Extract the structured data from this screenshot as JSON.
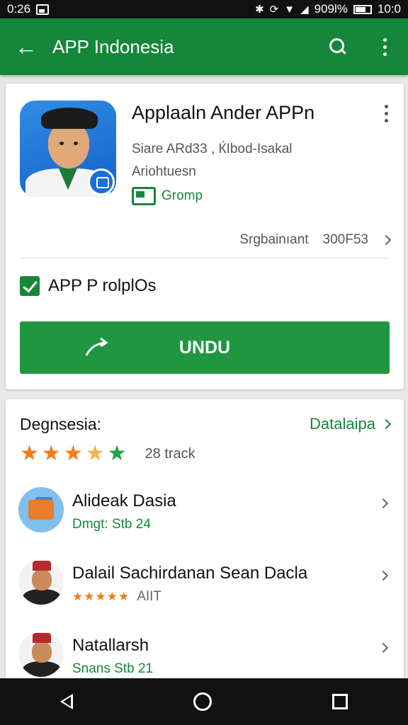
{
  "status_bar": {
    "time": "0:26",
    "battery": "909l%",
    "clock": "10:0"
  },
  "app_bar": {
    "title": "APP Indonesia"
  },
  "app": {
    "title": "Applaaln Ander APPn",
    "developer": "Siare ARd33 , ЌІbod-Isakal",
    "category": "Ariohtuesn",
    "group": "Gromp",
    "meta_label": "Srgbainıant",
    "meta_value": "300F53"
  },
  "checkbox_label": "APP P rolplOs",
  "install_label": "UNDU",
  "reviews": {
    "heading": "Degnsesia:",
    "link": "Datalaipa",
    "rating": 3.5,
    "count": "28 track"
  },
  "list": [
    {
      "name": "Alideak Dasia",
      "sub": "Dmgt: Stb 24"
    },
    {
      "name": "Dalail Sachirdanan Sean Dacla",
      "stars": "★★★★★",
      "sub": "AIIT"
    },
    {
      "name": "Natallarsh",
      "sub": "Snans Stb 21"
    }
  ],
  "colors": {
    "brand_green": "#16873a",
    "button_green": "#1e9740",
    "star_orange": "#f07d17"
  }
}
